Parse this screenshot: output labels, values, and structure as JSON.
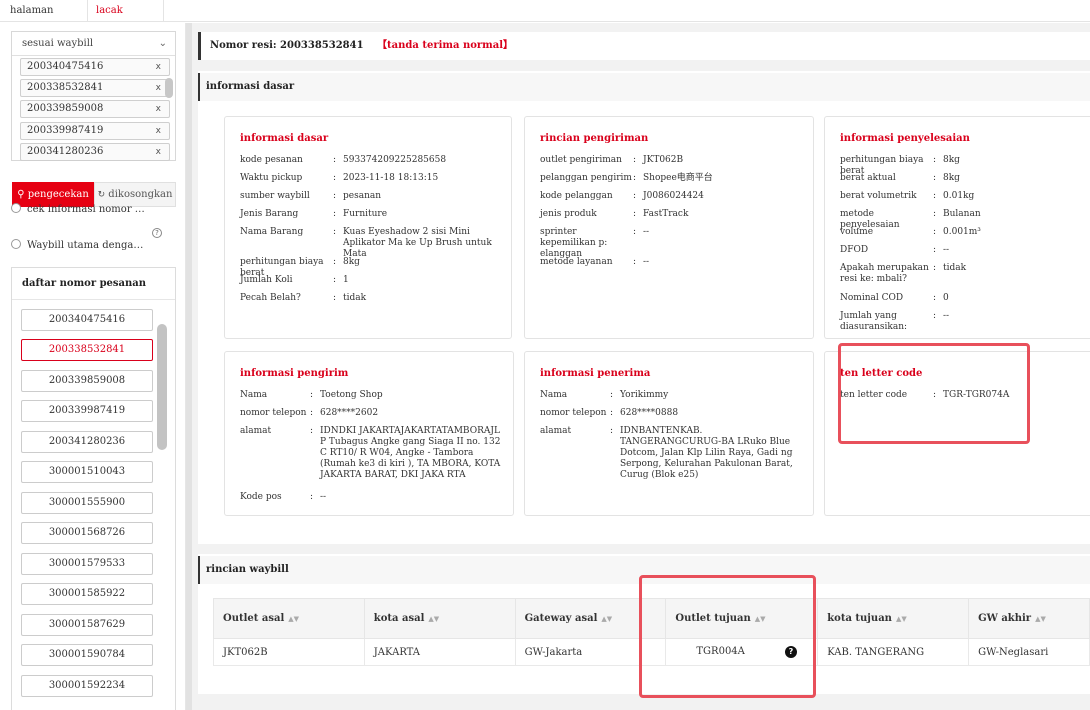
{
  "tabs": [
    {
      "label": "halaman utama"
    },
    {
      "label": "lacak paket",
      "close": "×"
    }
  ],
  "search": {
    "mode": "sesuai waybill",
    "waybills": [
      "200340475416",
      "200338532841",
      "200339859008",
      "200339987419",
      "200341280236"
    ],
    "remove_icon": "x",
    "search_button": "pengecekan",
    "clear_button": "dikosongkan",
    "options": [
      "cek informasi nomor …",
      "Waybill utama denga…"
    ]
  },
  "order_list": {
    "title": "daftar nomor pesanan",
    "items": [
      "200340475416",
      "200338532841",
      "200339859008",
      "200339987419",
      "200341280236",
      "300001510043",
      "300001555900",
      "300001568726",
      "300001579533",
      "300001585922",
      "300001587629",
      "300001590784",
      "300001592234"
    ],
    "active_index": 1
  },
  "header": {
    "label": "Nomor resi:",
    "resi": "200338532841",
    "status": "【tanda terima normal】"
  },
  "basic_info": {
    "section_title": "informasi dasar",
    "card_dasar": {
      "title": "informasi dasar",
      "rows": [
        {
          "k": "kode pesanan",
          "v": "593374209225285658"
        },
        {
          "k": "Waktu pickup",
          "v": "2023-11-18 18:13:15"
        },
        {
          "k": "sumber waybill",
          "v": "pesanan"
        },
        {
          "k": "Jenis Barang",
          "v": "Furniture"
        },
        {
          "k": "Nama Barang",
          "v": "Kuas Eyeshadow 2 sisi Mini Aplikator Ma ke Up Brush untuk Mata"
        },
        {
          "k": "perhitungan biaya berat",
          "v": "8kg"
        },
        {
          "k": "Jumlah Koli",
          "v": "1"
        },
        {
          "k": "Pecah Belah?",
          "v": "tidak"
        }
      ]
    },
    "card_pengiriman": {
      "title": "rincian pengiriman",
      "rows": [
        {
          "k": "outlet pengiriman",
          "v": "JKT062B"
        },
        {
          "k": "pelanggan pengirim",
          "v": "Shopee电商平台"
        },
        {
          "k": "kode pelanggan",
          "v": "J0086024424"
        },
        {
          "k": "jenis produk",
          "v": "FastTrack"
        },
        {
          "k": "sprinter kepemilikan p: elanggan",
          "v": "--"
        },
        {
          "k": "metode layanan",
          "v": "--"
        }
      ]
    },
    "card_penyelesaian": {
      "title": "informasi penyelesaian",
      "rows": [
        {
          "k": "perhitungan biaya berat",
          "v": "8kg"
        },
        {
          "k": "berat aktual",
          "v": "8kg"
        },
        {
          "k": "berat volumetrik",
          "v": "0.01kg"
        },
        {
          "k": "metode penyelesaian",
          "v": "Bulanan"
        },
        {
          "k": "volume",
          "v": "0.001m³"
        },
        {
          "k": "DFOD",
          "v": "--"
        },
        {
          "k": "Apakah merupakan resi ke: mbali?",
          "v": "tidak"
        },
        {
          "k": "Nominal COD",
          "v": "0"
        },
        {
          "k": "Jumlah yang diasuransikan:",
          "v": "--"
        }
      ]
    },
    "card_pengirim": {
      "title": "informasi pengirim",
      "rows": [
        {
          "k": "Nama",
          "v": "Toetong Shop"
        },
        {
          "k": "nomor telepon",
          "v": "628****2602"
        },
        {
          "k": "alamat",
          "v": "IDNDKI JAKARTAJAKARTATAMBORAJL P Tubagus Angke gang Siaga II no. 132 C RT10/ R W04, Angke - Tambora (Rumah ke3 di kiri ), TA MBORA, KOTA JAKARTA BARAT, DKI JAKA RTA"
        },
        {
          "k": "Kode pos",
          "v": "--"
        }
      ]
    },
    "card_penerima": {
      "title": "informasi penerima",
      "rows": [
        {
          "k": "Nama",
          "v": "Yorikimmy"
        },
        {
          "k": "nomor telepon",
          "v": "628****0888"
        },
        {
          "k": "alamat",
          "v": "IDNBANTENKAB. TANGERANGCURUG-BA LRuko Blue Dotcom, Jalan Klp Lilin Raya, Gadi ng Serpong, Kelurahan Pakulonan Barat, Curug (Blok e25)"
        }
      ]
    },
    "card_letter": {
      "title": "ten letter code",
      "rows": [
        {
          "k": "ten letter code",
          "v": "TGR-TGR074A"
        }
      ]
    }
  },
  "waybill_detail": {
    "section_title": "rincian waybill",
    "columns": [
      "Outlet asal",
      "kota asal",
      "Gateway asal",
      "Outlet tujuan",
      "kota tujuan",
      "GW akhir"
    ],
    "row": [
      "JKT062B",
      "JAKARTA",
      "GW-Jakarta",
      "TGR004A",
      "KAB. TANGERANG",
      "GW-Neglasari"
    ]
  },
  "colors": {
    "accent": "#d9001b",
    "highlight": "#e8505b"
  }
}
